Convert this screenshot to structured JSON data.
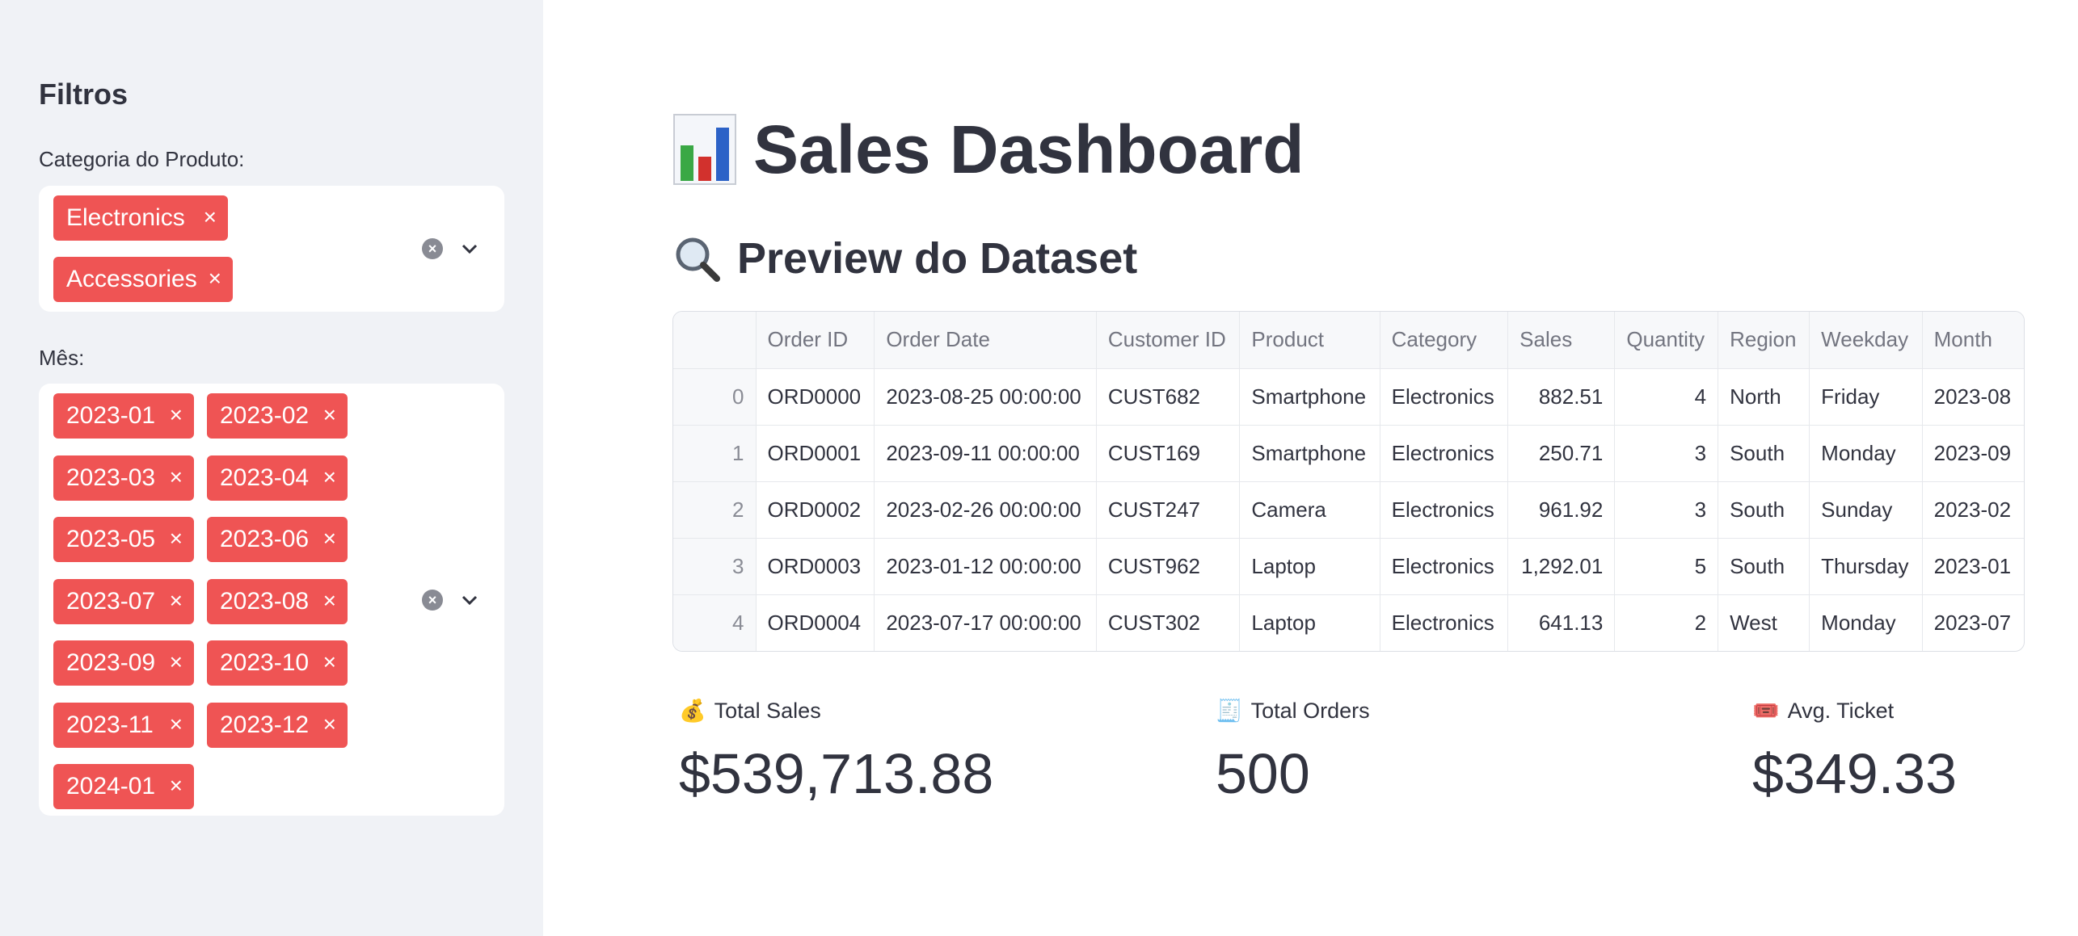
{
  "sidebar": {
    "title": "Filtros",
    "category": {
      "label": "Categoria do Produto:",
      "selected": [
        "Electronics",
        "Accessories"
      ]
    },
    "month": {
      "label": "Mês:",
      "selected": [
        "2023-01",
        "2023-02",
        "2023-03",
        "2023-04",
        "2023-05",
        "2023-06",
        "2023-07",
        "2023-08",
        "2023-09",
        "2023-10",
        "2023-11",
        "2023-12",
        "2024-01"
      ]
    },
    "remove_glyph": "×"
  },
  "main": {
    "title": "Sales Dashboard",
    "title_icon": "bar-chart-emoji",
    "preview_title": "Preview do Dataset",
    "preview_icon": "magnifier-emoji",
    "table": {
      "columns": [
        "",
        "Order ID",
        "Order Date",
        "Customer ID",
        "Product",
        "Category",
        "Sales",
        "Quantity",
        "Region",
        "Weekday",
        "Month"
      ],
      "rows": [
        [
          "0",
          "ORD0000",
          "2023-08-25 00:00:00",
          "CUST682",
          "Smartphone",
          "Electronics",
          "882.51",
          "4",
          "North",
          "Friday",
          "2023-08"
        ],
        [
          "1",
          "ORD0001",
          "2023-09-11 00:00:00",
          "CUST169",
          "Smartphone",
          "Electronics",
          "250.71",
          "3",
          "South",
          "Monday",
          "2023-09"
        ],
        [
          "2",
          "ORD0002",
          "2023-02-26 00:00:00",
          "CUST247",
          "Camera",
          "Electronics",
          "961.92",
          "3",
          "South",
          "Sunday",
          "2023-02"
        ],
        [
          "3",
          "ORD0003",
          "2023-01-12 00:00:00",
          "CUST962",
          "Laptop",
          "Electronics",
          "1,292.01",
          "5",
          "South",
          "Thursday",
          "2023-01"
        ],
        [
          "4",
          "ORD0004",
          "2023-07-17 00:00:00",
          "CUST302",
          "Laptop",
          "Electronics",
          "641.13",
          "2",
          "West",
          "Monday",
          "2023-07"
        ]
      ]
    },
    "metrics": [
      {
        "label": "Total Sales",
        "value": "$539,713.88",
        "icon": "money-bag-emoji"
      },
      {
        "label": "Total Orders",
        "value": "500",
        "icon": "receipt-emoji"
      },
      {
        "label": "Avg. Ticket",
        "value": "$349.33",
        "icon": "ticket-emoji"
      }
    ]
  },
  "colors": {
    "tag_bg": "#ef5454",
    "sidebar_bg": "#f0f2f6",
    "text": "#31333f"
  }
}
